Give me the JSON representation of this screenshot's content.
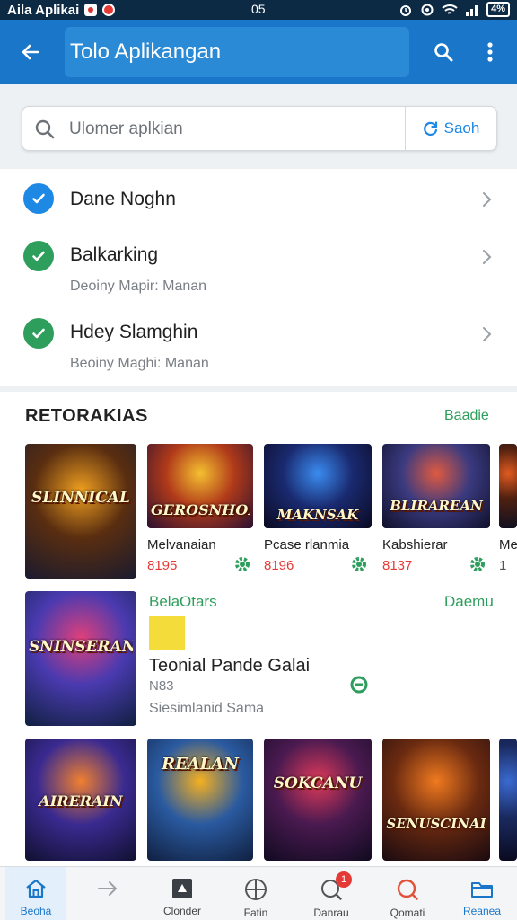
{
  "status_bar": {
    "app_label": "Aila Aplikai",
    "time": "05",
    "battery": "4%"
  },
  "app_bar": {
    "title": "Tolo Aplikangan",
    "icons": [
      "back-arrow-icon",
      "search-icon",
      "more-vert-icon"
    ]
  },
  "search": {
    "placeholder": "Ulomer aplkian",
    "sync_label": "Saoh"
  },
  "list_items": [
    {
      "title": "Dane Noghn",
      "subtitle": "",
      "icon_color": "#1e88e5"
    },
    {
      "title": "Balkarking",
      "subtitle": "Deoiny Mapir: Manan",
      "icon_color": "#2e9e5c"
    },
    {
      "title": "Hdey Slamghin",
      "subtitle": "Beoiny Maghi: Manan",
      "icon_color": "#2e9e5c"
    }
  ],
  "section": {
    "title": "RETORAKIAS",
    "link": "Baadie"
  },
  "games_row1": [
    {
      "art_title": "SLINNICAL",
      "name": "",
      "price": "",
      "palette": [
        "#f0a020",
        "#5a2e10",
        "#1a1a2e"
      ]
    },
    {
      "art_title": "GEROSNHON",
      "name": "Melvanaian",
      "price": "8195",
      "palette": [
        "#f5c030",
        "#b03a1a",
        "#2a1030"
      ]
    },
    {
      "art_title": "MAKNSAK",
      "name": "Pcase rlanmia",
      "price": "8196",
      "palette": [
        "#3a8cf0",
        "#1a2a70",
        "#0a0a20"
      ]
    },
    {
      "art_title": "BLIRAREAN",
      "name": "Kabshierar",
      "price": "8137",
      "palette": [
        "#e05a40",
        "#3a3a80",
        "#10102a"
      ]
    },
    {
      "art_title": "",
      "name": "Me",
      "price": "1",
      "palette": [
        "#e05a20",
        "#502010",
        "#101020"
      ]
    }
  ],
  "featured": {
    "art_title": "SNINSERAN",
    "label": "BelaOtars",
    "link": "Daemu",
    "title": "Teonial Pande Galai",
    "subtitle": "N83",
    "meta": "Siesimlanid Sama",
    "palette": [
      "#e0407a",
      "#4a3ab0",
      "#102040"
    ]
  },
  "games_row2": [
    {
      "art_title": "AIRERAIN",
      "palette": [
        "#f08030",
        "#3a2a90",
        "#101030"
      ]
    },
    {
      "art_title": "REALAN",
      "palette": [
        "#f5b020",
        "#2a5aa0",
        "#102040"
      ]
    },
    {
      "art_title": "SOKCANU",
      "palette": [
        "#e03a5a",
        "#4a1a50",
        "#100a20"
      ]
    },
    {
      "art_title": "SENUSCINAI",
      "palette": [
        "#f07a20",
        "#6a2a10",
        "#1a0a10"
      ]
    },
    {
      "art_title": "",
      "palette": [
        "#3a6ad0",
        "#1a2a60",
        "#0a0a20"
      ]
    }
  ],
  "bottom_nav": [
    {
      "label": "Beoha",
      "icon": "home-icon",
      "active": true
    },
    {
      "label": "",
      "icon": "arrow-right-icon",
      "active": false
    },
    {
      "label": "Clonder",
      "icon": "store-icon",
      "active": false
    },
    {
      "label": "Fatin",
      "icon": "globe-icon",
      "active": false
    },
    {
      "label": "Danrau",
      "icon": "notification-search-icon",
      "active": false,
      "badge": "1"
    },
    {
      "label": "Qomati",
      "icon": "search-chat-icon",
      "active": false
    },
    {
      "label": "Reanea",
      "icon": "folder-icon",
      "active": false
    }
  ],
  "colors": {
    "app_bar": "#1976c8",
    "status_bar": "#0d2a44",
    "accent_green": "#2e9e5c",
    "price_red": "#e53935"
  }
}
